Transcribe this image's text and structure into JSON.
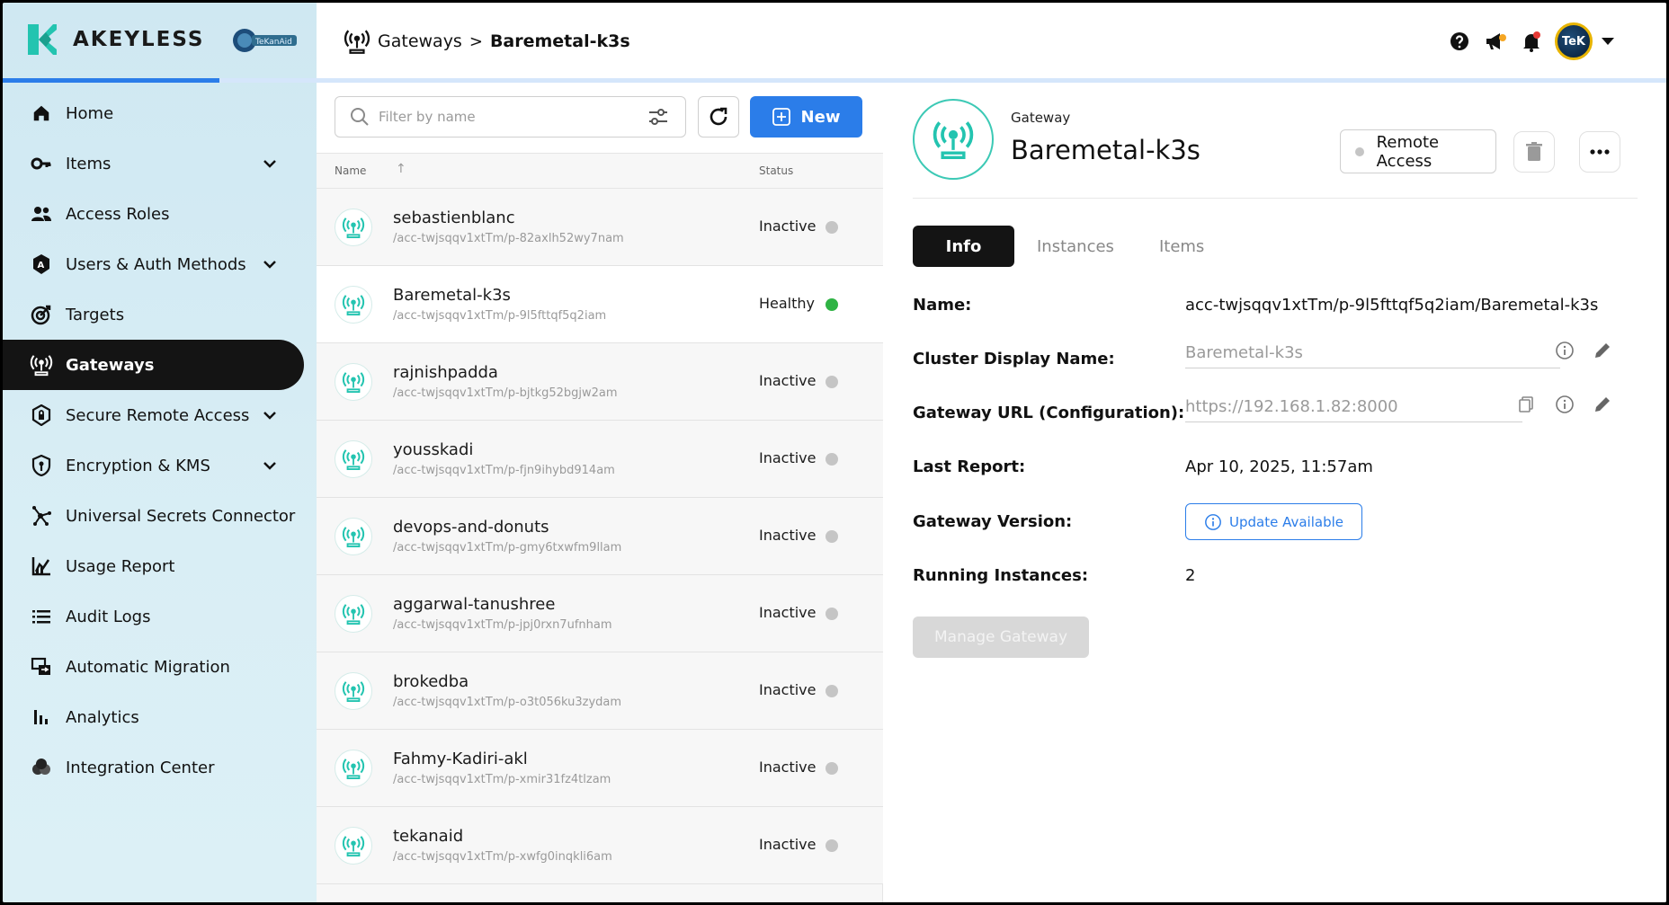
{
  "brand": {
    "name": "AKEYLESS",
    "partner_logo": "TeKanAid"
  },
  "nav": {
    "items": [
      {
        "label": "Home",
        "icon": "home-icon",
        "expandable": false,
        "active": false
      },
      {
        "label": "Items",
        "icon": "key-icon",
        "expandable": true,
        "active": false
      },
      {
        "label": "Access Roles",
        "icon": "users-icon",
        "expandable": false,
        "active": false
      },
      {
        "label": "Users & Auth Methods",
        "icon": "auth-methods-icon",
        "expandable": true,
        "active": false
      },
      {
        "label": "Targets",
        "icon": "target-icon",
        "expandable": false,
        "active": false
      },
      {
        "label": "Gateways",
        "icon": "gateway-icon",
        "expandable": false,
        "active": true
      },
      {
        "label": "Secure Remote Access",
        "icon": "shield-lock-icon",
        "expandable": true,
        "active": false
      },
      {
        "label": "Encryption & KMS",
        "icon": "shield-key-icon",
        "expandable": true,
        "active": false
      },
      {
        "label": "Universal Secrets Connector",
        "icon": "connector-icon",
        "expandable": false,
        "active": false
      },
      {
        "label": "Usage Report",
        "icon": "usage-chart-icon",
        "expandable": false,
        "active": false
      },
      {
        "label": "Audit Logs",
        "icon": "list-icon",
        "expandable": false,
        "active": false
      },
      {
        "label": "Automatic Migration",
        "icon": "migration-icon",
        "expandable": false,
        "active": false
      },
      {
        "label": "Analytics",
        "icon": "bar-chart-icon",
        "expandable": false,
        "active": false
      },
      {
        "label": "Integration Center",
        "icon": "integration-icon",
        "expandable": false,
        "active": false
      }
    ]
  },
  "topbar": {
    "breadcrumb": {
      "parent": "Gateways",
      "separator": ">",
      "current": "Baremetal-k3s"
    },
    "avatar_text": "TeK",
    "progress_fraction": 0.13
  },
  "list": {
    "search_placeholder": "Filter by name",
    "new_label": "New",
    "col_name": "Name",
    "col_status": "Status",
    "sort_arrow": "↑",
    "rows": [
      {
        "name": "sebastienblanc",
        "path": "/acc-twjsqqv1xtTm/p-82axlh52wy7nam",
        "status": "Inactive",
        "healthy": false,
        "selected": false
      },
      {
        "name": "Baremetal-k3s",
        "path": "/acc-twjsqqv1xtTm/p-9l5fttqf5q2iam",
        "status": "Healthy",
        "healthy": true,
        "selected": true
      },
      {
        "name": "rajnishpadda",
        "path": "/acc-twjsqqv1xtTm/p-bjtkg52bgjw2am",
        "status": "Inactive",
        "healthy": false,
        "selected": false
      },
      {
        "name": "yousskadi",
        "path": "/acc-twjsqqv1xtTm/p-fjn9ihybd914am",
        "status": "Inactive",
        "healthy": false,
        "selected": false
      },
      {
        "name": "devops-and-donuts",
        "path": "/acc-twjsqqv1xtTm/p-gmy6txwfm9llam",
        "status": "Inactive",
        "healthy": false,
        "selected": false
      },
      {
        "name": "aggarwal-tanushree",
        "path": "/acc-twjsqqv1xtTm/p-jpj0rxn7ufnham",
        "status": "Inactive",
        "healthy": false,
        "selected": false
      },
      {
        "name": "brokedba",
        "path": "/acc-twjsqqv1xtTm/p-o3t056ku3zydam",
        "status": "Inactive",
        "healthy": false,
        "selected": false
      },
      {
        "name": "Fahmy-Kadiri-akl",
        "path": "/acc-twjsqqv1xtTm/p-xmir31fz4tlzam",
        "status": "Inactive",
        "healthy": false,
        "selected": false
      },
      {
        "name": "tekanaid",
        "path": "/acc-twjsqqv1xtTm/p-xwfg0inqkli6am",
        "status": "Inactive",
        "healthy": false,
        "selected": false
      }
    ]
  },
  "detail": {
    "subtitle": "Gateway",
    "title": "Baremetal-k3s",
    "remote_access_label": "Remote Access",
    "tabs": [
      {
        "label": "Info",
        "active": true
      },
      {
        "label": "Instances",
        "active": false
      },
      {
        "label": "Items",
        "active": false
      }
    ],
    "fields": {
      "name_label": "Name:",
      "name_value": "acc-twjsqqv1xtTm/p-9l5fttqf5q2iam/Baremetal-k3s",
      "cluster_label": "Cluster Display Name:",
      "cluster_value": "Baremetal-k3s",
      "url_label": "Gateway URL (Configuration):",
      "url_value": "https://192.168.1.82:8000",
      "report_label": "Last Report:",
      "report_value": "Apr 10, 2025, 11:57am",
      "version_label": "Gateway Version:",
      "update_label": "Update Available",
      "instances_label": "Running Instances:",
      "instances_value": "2"
    },
    "manage_label": "Manage Gateway"
  },
  "colors": {
    "accent": "#2b7de9",
    "teal": "#3cc9b5",
    "healthy": "#2fb344",
    "inactive": "#c5c5c5",
    "active_nav": "#141414"
  }
}
